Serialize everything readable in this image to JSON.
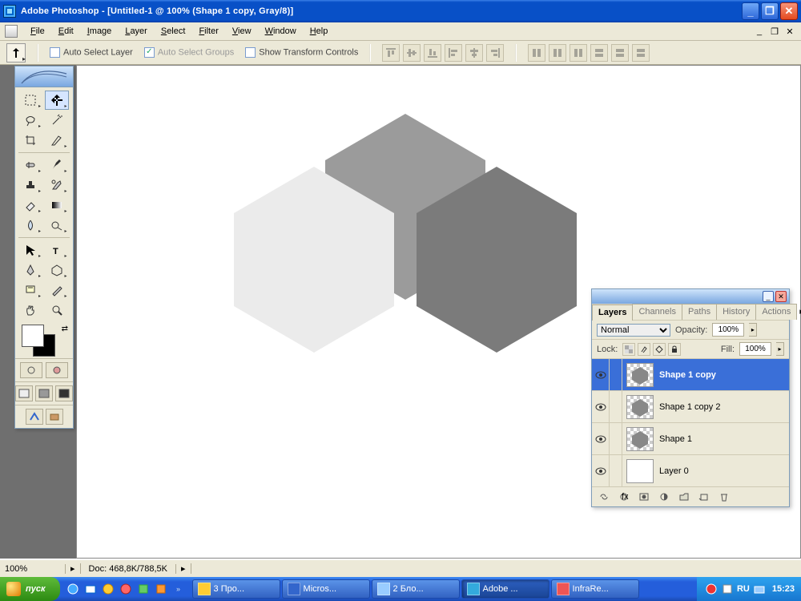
{
  "titlebar": {
    "text": "Adobe Photoshop - [Untitled-1 @ 100% (Shape 1 copy, Gray/8)]"
  },
  "menus": [
    "File",
    "Edit",
    "Image",
    "Layer",
    "Select",
    "Filter",
    "View",
    "Window",
    "Help"
  ],
  "optionsbar": {
    "auto_select_layer": "Auto Select Layer",
    "auto_select_groups": "Auto Select Groups",
    "show_transform": "Show Transform Controls"
  },
  "layers_panel": {
    "tabs": [
      "Layers",
      "Channels",
      "Paths",
      "History",
      "Actions"
    ],
    "blend_mode": "Normal",
    "opacity_label": "Opacity:",
    "opacity_value": "100%",
    "lock_label": "Lock:",
    "fill_label": "Fill:",
    "fill_value": "100%",
    "layers": [
      {
        "name": "Shape 1 copy",
        "selected": true,
        "thumb": "trans"
      },
      {
        "name": "Shape 1 copy 2",
        "selected": false,
        "thumb": "trans"
      },
      {
        "name": "Shape 1",
        "selected": false,
        "thumb": "trans"
      },
      {
        "name": "Layer 0",
        "selected": false,
        "thumb": "white"
      }
    ]
  },
  "statusbar": {
    "zoom": "100%",
    "doc": "Doc: 468,8K/788,5K"
  },
  "taskbar": {
    "start": "пуск",
    "buttons": [
      {
        "label": "3 Про...",
        "active": false
      },
      {
        "label": "Micros...",
        "active": false
      },
      {
        "label": "2 Бло...",
        "active": false
      },
      {
        "label": "Adobe ...",
        "active": true
      },
      {
        "label": "InfraRe...",
        "active": false
      }
    ],
    "lang": "RU",
    "time": "15:23"
  },
  "canvas_shapes": {
    "hex_top": "#9b9b9b",
    "hex_left": "#ebebeb",
    "hex_right": "#7b7b7b"
  }
}
